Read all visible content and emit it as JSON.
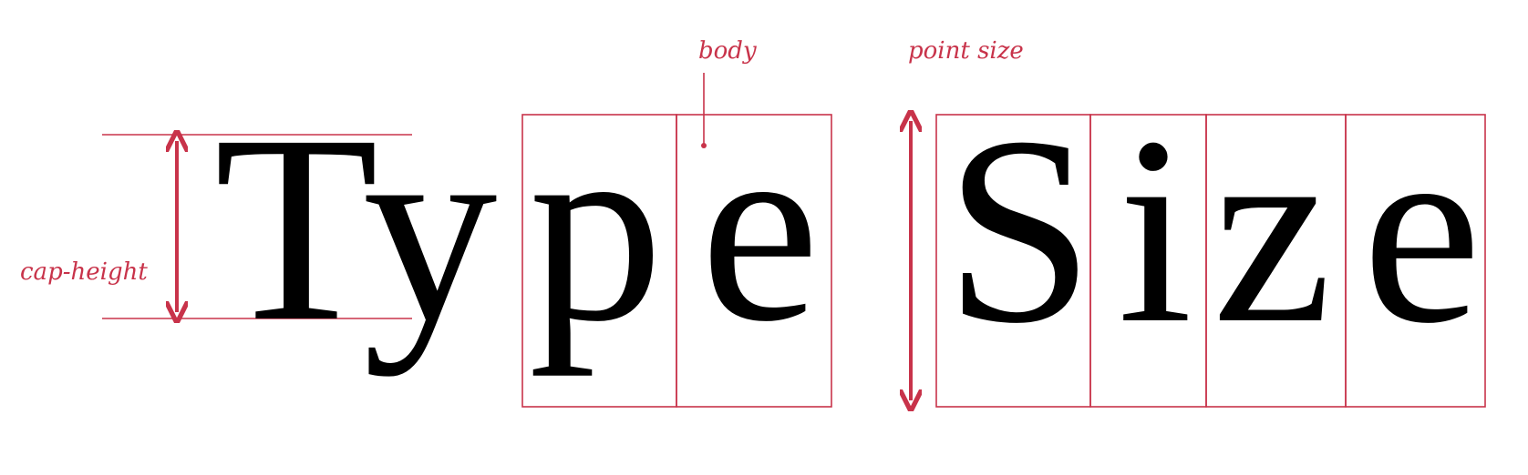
{
  "diagram": {
    "words": [
      "Type",
      "Size"
    ],
    "glyphs": {
      "type": [
        "T",
        "y",
        "p",
        "e"
      ],
      "size": [
        "S",
        "i",
        "z",
        "e"
      ]
    },
    "labels": {
      "body": "body",
      "point_size": "point size",
      "cap_height": "cap-height"
    },
    "colors": {
      "accent": "#c8334a",
      "glyph": "#000000",
      "background": "#ffffff"
    }
  }
}
